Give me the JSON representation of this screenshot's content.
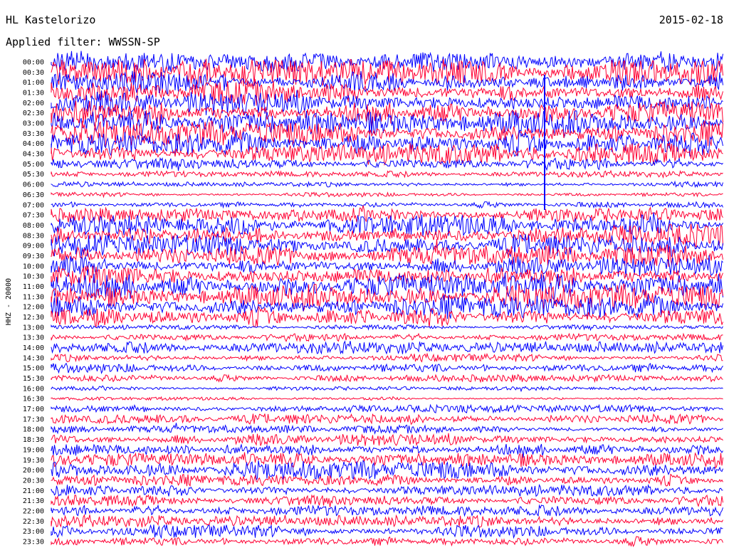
{
  "header": {
    "station": "HL Kastelorizo",
    "date": "2015-02-18",
    "filter_label": "Applied filter: WWSSN-SP"
  },
  "chart_data": {
    "type": "line",
    "ylabel": "HHZ - 20000",
    "title": "",
    "xlabel": "",
    "colors": [
      "#0000ff",
      "#ff0033"
    ],
    "grid": false,
    "legend": "none",
    "rows": [
      {
        "time": "00:00",
        "amp": 0.85,
        "color": "#0000ff"
      },
      {
        "time": "00:30",
        "amp": 1.0,
        "color": "#ff0033"
      },
      {
        "time": "01:00",
        "amp": 0.9,
        "color": "#0000ff"
      },
      {
        "time": "01:30",
        "amp": 1.0,
        "color": "#ff0033"
      },
      {
        "time": "02:00",
        "amp": 1.0,
        "color": "#0000ff"
      },
      {
        "time": "02:30",
        "amp": 1.0,
        "color": "#ff0033"
      },
      {
        "time": "03:00",
        "amp": 1.0,
        "color": "#0000ff"
      },
      {
        "time": "03:30",
        "amp": 1.0,
        "color": "#ff0033"
      },
      {
        "time": "04:00",
        "amp": 1.0,
        "color": "#0000ff"
      },
      {
        "time": "04:30",
        "amp": 0.85,
        "color": "#ff0033"
      },
      {
        "time": "05:00",
        "amp": 0.45,
        "color": "#0000ff"
      },
      {
        "time": "05:30",
        "amp": 0.25,
        "color": "#ff0033"
      },
      {
        "time": "06:00",
        "amp": 0.2,
        "color": "#0000ff"
      },
      {
        "time": "06:30",
        "amp": 0.18,
        "color": "#ff0033"
      },
      {
        "time": "07:00",
        "amp": 0.25,
        "color": "#0000ff"
      },
      {
        "time": "07:30",
        "amp": 0.55,
        "color": "#ff0033"
      },
      {
        "time": "08:00",
        "amp": 0.8,
        "color": "#0000ff"
      },
      {
        "time": "08:30",
        "amp": 0.9,
        "color": "#ff0033"
      },
      {
        "time": "09:00",
        "amp": 0.9,
        "color": "#0000ff"
      },
      {
        "time": "09:30",
        "amp": 0.85,
        "color": "#ff0033"
      },
      {
        "time": "10:00",
        "amp": 0.85,
        "color": "#0000ff"
      },
      {
        "time": "10:30",
        "amp": 0.95,
        "color": "#ff0033"
      },
      {
        "time": "11:00",
        "amp": 1.0,
        "color": "#0000ff"
      },
      {
        "time": "11:30",
        "amp": 1.0,
        "color": "#ff0033"
      },
      {
        "time": "12:00",
        "amp": 0.95,
        "color": "#0000ff"
      },
      {
        "time": "12:30",
        "amp": 0.8,
        "color": "#ff0033"
      },
      {
        "time": "13:00",
        "amp": 0.18,
        "color": "#0000ff"
      },
      {
        "time": "13:30",
        "amp": 0.3,
        "color": "#ff0033"
      },
      {
        "time": "14:00",
        "amp": 0.5,
        "color": "#0000ff"
      },
      {
        "time": "14:30",
        "amp": 0.3,
        "color": "#ff0033"
      },
      {
        "time": "15:00",
        "amp": 0.4,
        "color": "#0000ff"
      },
      {
        "time": "15:30",
        "amp": 0.28,
        "color": "#ff0033"
      },
      {
        "time": "16:00",
        "amp": 0.15,
        "color": "#0000ff"
      },
      {
        "time": "16:30",
        "amp": 0.12,
        "color": "#ff0033"
      },
      {
        "time": "17:00",
        "amp": 0.3,
        "color": "#0000ff"
      },
      {
        "time": "17:30",
        "amp": 0.42,
        "color": "#ff0033"
      },
      {
        "time": "18:00",
        "amp": 0.32,
        "color": "#0000ff"
      },
      {
        "time": "18:30",
        "amp": 0.5,
        "color": "#ff0033"
      },
      {
        "time": "19:00",
        "amp": 0.55,
        "color": "#0000ff"
      },
      {
        "time": "19:30",
        "amp": 0.55,
        "color": "#ff0033"
      },
      {
        "time": "20:00",
        "amp": 0.75,
        "color": "#0000ff"
      },
      {
        "time": "20:30",
        "amp": 0.45,
        "color": "#ff0033"
      },
      {
        "time": "21:00",
        "amp": 0.45,
        "color": "#0000ff"
      },
      {
        "time": "21:30",
        "amp": 0.42,
        "color": "#ff0033"
      },
      {
        "time": "22:00",
        "amp": 0.45,
        "color": "#0000ff"
      },
      {
        "time": "22:30",
        "amp": 0.48,
        "color": "#ff0033"
      },
      {
        "time": "23:00",
        "amp": 0.5,
        "color": "#0000ff"
      },
      {
        "time": "23:30",
        "amp": 0.4,
        "color": "#ff0033"
      }
    ]
  }
}
